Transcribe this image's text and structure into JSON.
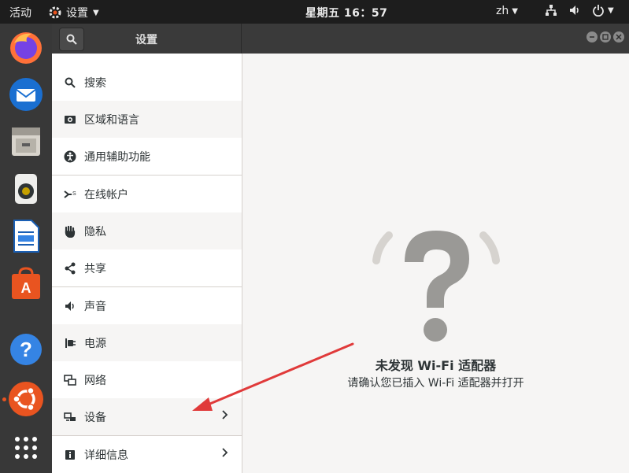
{
  "topbar": {
    "activities": "活动",
    "app_menu": "设置",
    "clock": "星期五 16：57",
    "lang": "zh"
  },
  "dock": {
    "apps": [
      "firefox-icon",
      "thunderbird-icon",
      "files-icon",
      "rhythmbox-icon",
      "libreoffice-writer-icon",
      "software-center-icon",
      "help-icon",
      "ubuntu-icon",
      "app-grid-icon"
    ]
  },
  "window": {
    "title": "设置",
    "sidebar": {
      "items": [
        {
          "label": "搜索",
          "icon": "search-icon"
        },
        {
          "label": "区域和语言",
          "icon": "camera-icon"
        },
        {
          "label": "通用辅助功能",
          "icon": "accessibility-icon"
        },
        {
          "label": "在线帐户",
          "icon": "online-accounts-icon"
        },
        {
          "label": "隐私",
          "icon": "hand-icon"
        },
        {
          "label": "共享",
          "icon": "share-icon"
        },
        {
          "label": "声音",
          "icon": "speaker-icon"
        },
        {
          "label": "电源",
          "icon": "power-plug-icon"
        },
        {
          "label": "网络",
          "icon": "network-icon"
        },
        {
          "label": "设备",
          "icon": "devices-icon"
        },
        {
          "label": "详细信息",
          "icon": "info-icon"
        }
      ]
    },
    "content": {
      "title": "未发现 Wi-Fi 适配器",
      "subtitle": "请确认您已插入 Wi-Fi 适配器并打开"
    }
  },
  "colors": {
    "accent": "#e95420",
    "annotation_arrow": "#e03a3a"
  }
}
